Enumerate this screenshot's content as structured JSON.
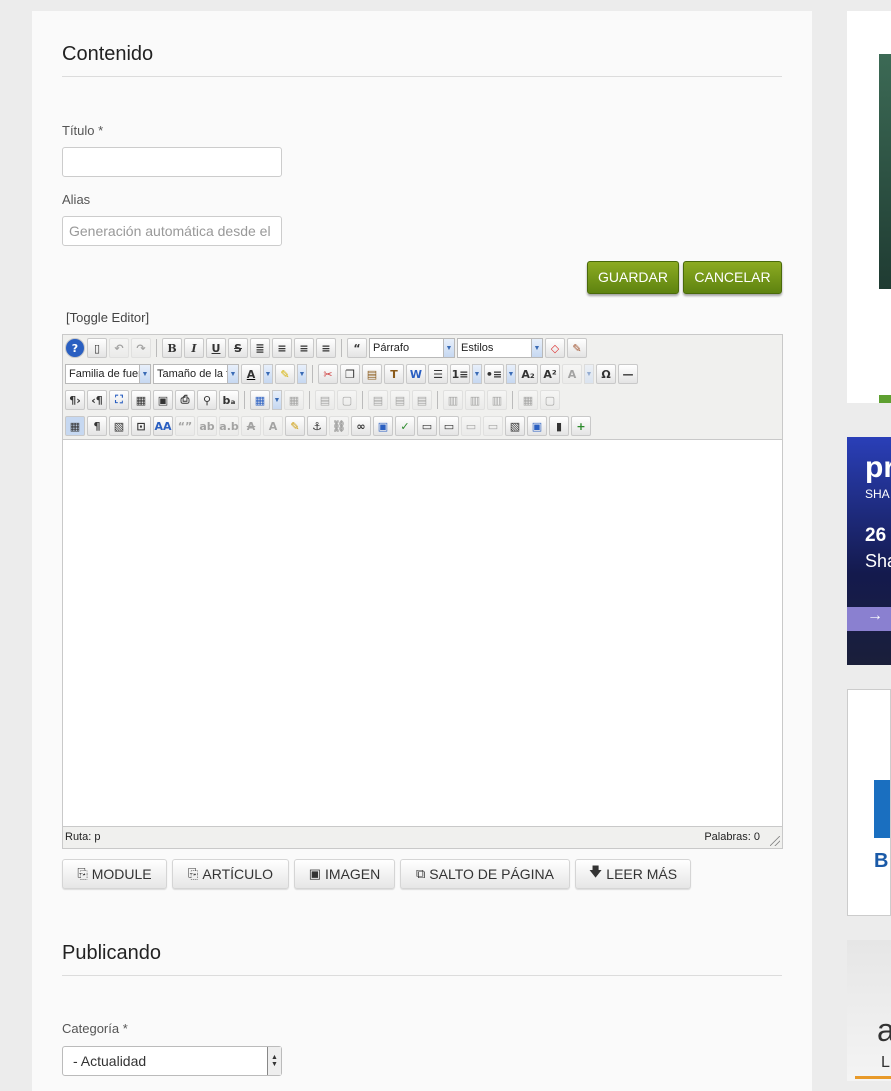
{
  "contenido": {
    "heading": "Contenido",
    "titulo_label": "Título *",
    "titulo_value": "",
    "alias_label": "Alias",
    "alias_placeholder": "Generación automática desde el",
    "guardar": "GUARDAR",
    "cancelar": "CANCELAR",
    "toggle_editor": "[Toggle Editor]"
  },
  "editor": {
    "format_select": "Párrafo",
    "styles_select": "Estilos",
    "font_family_select": "Familia de fuer",
    "font_size_select": "Tamaño de la f",
    "status_path": "Ruta: p",
    "status_words": "Palabras: 0"
  },
  "extra_buttons": [
    {
      "label": "MODULE",
      "icon": "module-icon"
    },
    {
      "label": "ARTÍCULO",
      "icon": "article-icon"
    },
    {
      "label": "IMAGEN",
      "icon": "image-icon"
    },
    {
      "label": "SALTO DE PÁGINA",
      "icon": "pagebreak-icon"
    },
    {
      "label": "LEER MÁS",
      "icon": "arrow-down-icon"
    }
  ],
  "publicando": {
    "heading": "Publicando",
    "categoria_label": "Categoría *",
    "categoria_value": "- Actualidad"
  },
  "ads": {
    "ad2_line1": "pr",
    "ad2_line2": "SHA",
    "ad2_line3": "26",
    "ad2_line4": "Sha",
    "ad3_text": "B",
    "ad4_line1": "a",
    "ad4_line2": "L"
  },
  "colors": {
    "button_green": "#6f9418",
    "ad_blue": "#1f3fa8",
    "ad_purple": "#7a6fc4"
  }
}
